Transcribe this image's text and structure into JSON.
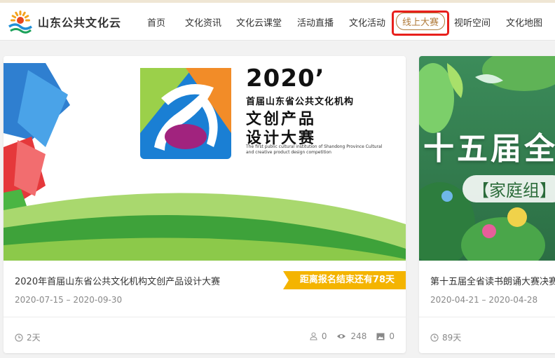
{
  "site": {
    "name": "山东公共文化云"
  },
  "nav": {
    "items": [
      "首页",
      "文化资讯",
      "文化云课堂",
      "活动直播",
      "文化活动",
      "线上大赛",
      "视听空间",
      "文化地图"
    ],
    "active_index": 5
  },
  "colors": {
    "accent": "#b07b3b",
    "highlight": "#e8201c",
    "ribbon": "#f4b400"
  },
  "cards": [
    {
      "title": "2020年首届山东省公共文化机构文创产品设计大赛",
      "date": "2020-07-15 – 2020-09-30",
      "ribbon": "距离报名结束还有78天",
      "duration": "2天",
      "participants": "0",
      "views": "248",
      "works": "0",
      "poster": {
        "year": "2020’",
        "line1": "首届山东省公共文化机构",
        "line2": "文创产品",
        "line3": "设计大赛",
        "en": "The first public cultural institution of Shandong Province Cultural and creative product design competition"
      }
    },
    {
      "title": "第十五届全省读书朗诵大赛决赛",
      "date": "2020-04-21 – 2020-04-28",
      "duration": "89天",
      "poster": {
        "line1": "十五届全",
        "line2": "【家庭组】"
      }
    }
  ]
}
